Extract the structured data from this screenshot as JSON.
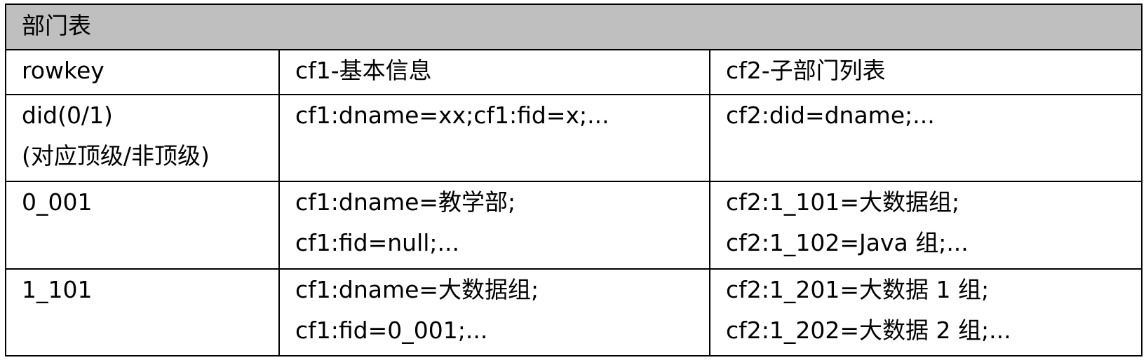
{
  "table": {
    "title": "部门表",
    "headers": [
      "rowkey",
      "cf1-基本信息",
      "cf2-子部门列表"
    ],
    "rows": [
      {
        "rowkey": [
          "did(0/1)",
          "(对应顶级/非顶级)"
        ],
        "cf1": [
          "cf1:dname=xx;cf1:fid=x;..."
        ],
        "cf2": [
          "cf2:did=dname;..."
        ]
      },
      {
        "rowkey": [
          "0_001"
        ],
        "cf1": [
          "cf1:dname=教学部;",
          "cf1:fid=null;..."
        ],
        "cf2": [
          "cf2:1_101=大数据组;",
          "cf2:1_102=Java 组;..."
        ]
      },
      {
        "rowkey": [
          "1_101"
        ],
        "cf1": [
          "cf1:dname=大数据组;",
          "cf1:fid=0_001;..."
        ],
        "cf2": [
          "cf2:1_201=大数据 1 组;",
          "cf2:1_202=大数据 2 组;..."
        ]
      }
    ]
  }
}
